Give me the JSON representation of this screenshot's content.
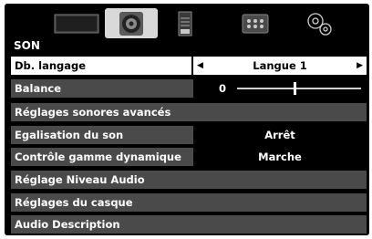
{
  "tabs": [
    {
      "icon": "picture-icon",
      "active": false
    },
    {
      "icon": "sound-icon",
      "active": true
    },
    {
      "icon": "document-icon",
      "active": false
    },
    {
      "icon": "grid-icon",
      "active": false
    },
    {
      "icon": "gears-icon",
      "active": false
    }
  ],
  "section_title": "SON",
  "rows": {
    "langage": {
      "label": "Db. langage",
      "value": "Langue 1"
    },
    "balance": {
      "label": "Balance",
      "value": "0",
      "slider_fraction": 0.46
    },
    "reglages_sonores": {
      "label": "Réglages sonores avancés"
    },
    "egalisation": {
      "label": "Egalisation du son",
      "value": "Arrêt"
    },
    "controle_gamme": {
      "label": "Contrôle gamme dynamique",
      "value": "Marche"
    },
    "niveau_audio": {
      "label": "Réglage Niveau Audio"
    },
    "casque": {
      "label": "Réglages du casque"
    },
    "audio_description": {
      "label": "Audio Description"
    }
  },
  "colors": {
    "background": "#000000",
    "row": "#4a4a4a",
    "selected": "#ffffff",
    "text": "#ffffff"
  }
}
